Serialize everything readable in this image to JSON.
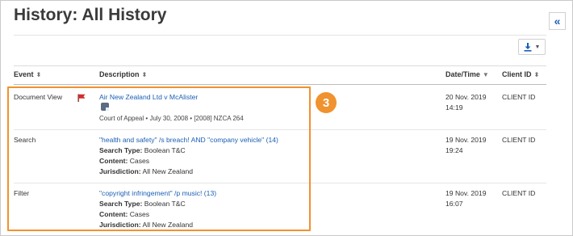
{
  "page": {
    "title": "History: All History"
  },
  "controls": {
    "collapse_icon": "double-chevron-left-icon",
    "download_icon": "download-icon"
  },
  "table": {
    "headers": {
      "event": "Event",
      "description": "Description",
      "datetime": "Date/Time",
      "client_id": "Client ID"
    },
    "rows": [
      {
        "event": "Document View",
        "title": "Air New Zealand Ltd v McAlister",
        "court": "Court of Appeal",
        "sep": "•",
        "date": "July 30, 2008",
        "citation": "[2008] NZCA 264",
        "date_line1": "20 Nov. 2019",
        "date_line2": "14:19",
        "client_id": "CLIENT ID"
      },
      {
        "event": "Search",
        "query": "\"health and safety\" /s breach! AND \"company vehicle\" (14)",
        "search_type_label": "Search Type:",
        "search_type": "Boolean T&C",
        "content_label": "Content:",
        "content": "Cases",
        "jurisdiction_label": "Jurisdiction:",
        "jurisdiction": "All New Zealand",
        "date_line1": "19 Nov. 2019",
        "date_line2": "19:24",
        "client_id": "CLIENT ID"
      },
      {
        "event": "Filter",
        "query": "\"copyright infringement\" /p music! (13)",
        "search_type_label": "Search Type:",
        "search_type": "Boolean T&C",
        "content_label": "Content:",
        "content": "Cases",
        "jurisdiction_label": "Jurisdiction:",
        "jurisdiction": "All New Zealand",
        "date_line1": "19 Nov. 2019",
        "date_line2": "16:07",
        "client_id": "CLIENT ID"
      }
    ]
  },
  "callout": {
    "number": "3"
  },
  "colors": {
    "accent": "#f0922e",
    "link": "#1a5fb4",
    "flag": "#d62b2b"
  }
}
